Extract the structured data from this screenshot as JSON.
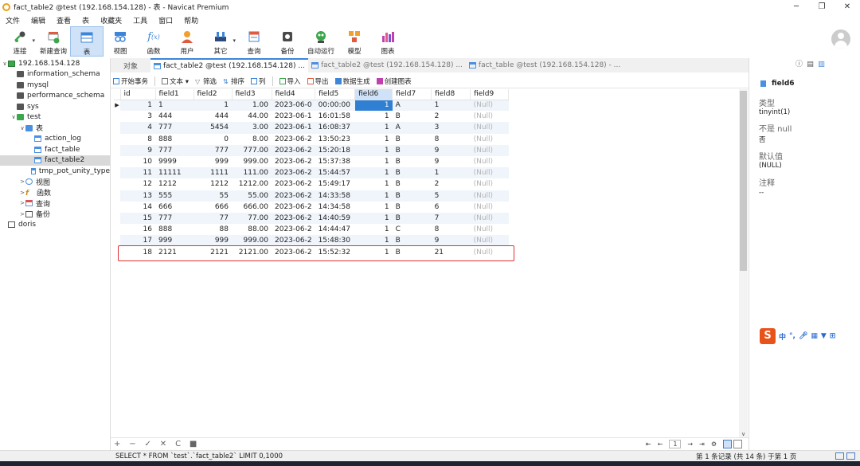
{
  "window": {
    "title": "fact_table2 @test (192.168.154.128) - 表 - Navicat Premium",
    "controls": [
      "─",
      "❐",
      "✕"
    ]
  },
  "menu": [
    "文件",
    "编辑",
    "查看",
    "表",
    "收藏夹",
    "工具",
    "窗口",
    "帮助"
  ],
  "toolbar": [
    {
      "label": "连接",
      "icon": "connect-icon"
    },
    {
      "label": "新建查询",
      "icon": "new-query-icon"
    },
    {
      "label": "表",
      "icon": "table-icon"
    },
    {
      "label": "视图",
      "icon": "view-icon"
    },
    {
      "label": "函数",
      "icon": "function-icon"
    },
    {
      "label": "用户",
      "icon": "user-icon"
    },
    {
      "label": "其它",
      "icon": "other-icon"
    },
    {
      "label": "查询",
      "icon": "query-icon"
    },
    {
      "label": "备份",
      "icon": "backup-icon"
    },
    {
      "label": "自动运行",
      "icon": "automation-icon"
    },
    {
      "label": "模型",
      "icon": "model-icon"
    },
    {
      "label": "图表",
      "icon": "chart-icon"
    }
  ],
  "sidebar": {
    "items": [
      {
        "label": "192.168.154.128",
        "level": 0,
        "caret": "∨",
        "icon": "ico-conn"
      },
      {
        "label": "information_schema",
        "level": 1,
        "caret": "",
        "icon": "ico-db"
      },
      {
        "label": "mysql",
        "level": 1,
        "caret": "",
        "icon": "ico-db"
      },
      {
        "label": "performance_schema",
        "level": 1,
        "caret": "",
        "icon": "ico-db"
      },
      {
        "label": "sys",
        "level": 1,
        "caret": "",
        "icon": "ico-db"
      },
      {
        "label": "test",
        "level": 1,
        "caret": "∨",
        "icon": "ico-dbg"
      },
      {
        "label": "表",
        "level": 2,
        "caret": "∨",
        "icon": "ico-tablef"
      },
      {
        "label": "action_log",
        "level": 3,
        "caret": "",
        "icon": "ico-table"
      },
      {
        "label": "fact_table",
        "level": 3,
        "caret": "",
        "icon": "ico-table"
      },
      {
        "label": "fact_table2",
        "level": 3,
        "caret": "",
        "icon": "ico-table",
        "selected": true
      },
      {
        "label": "tmp_pot_unity_type",
        "level": 3,
        "caret": "",
        "icon": "ico-table"
      },
      {
        "label": "视图",
        "level": 2,
        "caret": ">",
        "icon": "ico-view"
      },
      {
        "label": "函数",
        "level": 2,
        "caret": ">",
        "icon": "ico-fn"
      },
      {
        "label": "查询",
        "level": 2,
        "caret": ">",
        "icon": "ico-query"
      },
      {
        "label": "备份",
        "level": 2,
        "caret": ">",
        "icon": "ico-bak"
      },
      {
        "label": "doris",
        "level": 0,
        "caret": "",
        "icon": "ico-doris"
      }
    ]
  },
  "tabs": {
    "objects": "对象",
    "items": [
      {
        "label": "fact_table2 @test (192.168.154.128) ...",
        "active": true
      },
      {
        "label": "fact_table2 @test (192.168.154.128) ...",
        "active": false
      },
      {
        "label": "fact_table @test (192.168.154.128) - ...",
        "active": false
      }
    ]
  },
  "datatoolbar": [
    "开始事务",
    "文本 ▾",
    "筛选",
    "排序",
    "列",
    "导入",
    "导出",
    "数据生成",
    "创建图表"
  ],
  "grid": {
    "columns": [
      "id",
      "field1",
      "field2",
      "field3",
      "field4",
      "field5",
      "field6",
      "field7",
      "field8",
      "field9"
    ],
    "selected_column": "field6",
    "rows": [
      [
        "1",
        "1",
        "1",
        "1.00",
        "2023-06-0",
        "00:00:00",
        "1",
        "A",
        "1",
        "(Null)"
      ],
      [
        "3",
        "444",
        "444",
        "44.00",
        "2023-06-1",
        "16:01:58",
        "1",
        "B",
        "2",
        "(Null)"
      ],
      [
        "4",
        "777",
        "5454",
        "3.00",
        "2023-06-1",
        "16:08:37",
        "1",
        "A",
        "3",
        "(Null)"
      ],
      [
        "8",
        "888",
        "0",
        "8.00",
        "2023-06-2",
        "13:50:23",
        "1",
        "B",
        "8",
        "(Null)"
      ],
      [
        "9",
        "777",
        "777",
        "777.00",
        "2023-06-2",
        "15:20:18",
        "1",
        "B",
        "9",
        "(Null)"
      ],
      [
        "10",
        "9999",
        "999",
        "999.00",
        "2023-06-2",
        "15:37:38",
        "1",
        "B",
        "9",
        "(Null)"
      ],
      [
        "11",
        "11111",
        "1111",
        "111.00",
        "2023-06-2",
        "15:44:57",
        "1",
        "B",
        "1",
        "(Null)"
      ],
      [
        "12",
        "1212",
        "1212",
        "1212.00",
        "2023-06-2",
        "15:49:17",
        "1",
        "B",
        "2",
        "(Null)"
      ],
      [
        "13",
        "555",
        "55",
        "55.00",
        "2023-06-2",
        "14:33:58",
        "1",
        "B",
        "5",
        "(Null)"
      ],
      [
        "14",
        "666",
        "666",
        "666.00",
        "2023-06-2",
        "14:34:58",
        "1",
        "B",
        "6",
        "(Null)"
      ],
      [
        "15",
        "777",
        "77",
        "77.00",
        "2023-06-2",
        "14:40:59",
        "1",
        "B",
        "7",
        "(Null)"
      ],
      [
        "16",
        "888",
        "88",
        "88.00",
        "2023-06-2",
        "14:44:47",
        "1",
        "C",
        "8",
        "(Null)"
      ],
      [
        "17",
        "999",
        "999",
        "999.00",
        "2023-06-2",
        "15:48:30",
        "1",
        "B",
        "9",
        "(Null)"
      ],
      [
        "18",
        "2121",
        "2121",
        "2121.00",
        "2023-06-2",
        "15:52:32",
        "1",
        "B",
        "21",
        "(Null)"
      ]
    ]
  },
  "bottombar": {
    "left_controls": [
      "+",
      "−",
      "✓",
      "✕",
      "C",
      "■"
    ],
    "nav_first": "⇤",
    "nav_prev": "←",
    "page": "1",
    "nav_next": "→",
    "nav_last": "⇥",
    "settings": "⚙"
  },
  "status": {
    "sql": "SELECT * FROM `test`.`fact_table2` LIMIT 0,1000",
    "record": "第 1 条记录 (共 14 条) 于第 1 页"
  },
  "rightpanel": {
    "field_name": "field6",
    "props": [
      {
        "label": "类型",
        "value": "tinyint(1)"
      },
      {
        "label": "不是 null",
        "value": "否"
      },
      {
        "label": "默认值",
        "value": "(NULL)"
      },
      {
        "label": "注释",
        "value": "--"
      }
    ]
  },
  "ime": {
    "logo": "S",
    "lang": "中"
  }
}
